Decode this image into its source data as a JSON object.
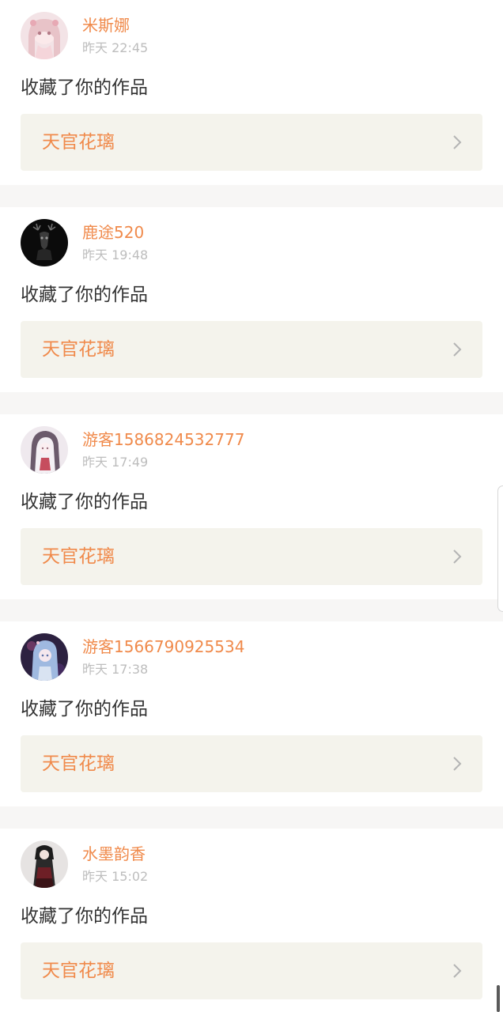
{
  "notifications": [
    {
      "username": "米斯娜",
      "time": "昨天 22:45",
      "action": "收藏了你的作品",
      "work_title": "天官花璃",
      "avatar_icon": "avatar-pink-anime-girl"
    },
    {
      "username": "鹿途520",
      "time": "昨天 19:48",
      "action": "收藏了你的作品",
      "work_title": "天官花璃",
      "avatar_icon": "avatar-deer-skull-dark"
    },
    {
      "username": "游客1586824532777",
      "time": "昨天 17:49",
      "action": "收藏了你的作品",
      "work_title": "天官花璃",
      "avatar_icon": "avatar-hooded-white-hair-girl"
    },
    {
      "username": "游客1566790925534",
      "time": "昨天 17:38",
      "action": "收藏了你的作品",
      "work_title": "天官花璃",
      "avatar_icon": "avatar-blue-hair-anime-girl"
    },
    {
      "username": "水墨韵香",
      "time": "昨天 15:02",
      "action": "收藏了你的作品",
      "work_title": "天官花璃",
      "avatar_icon": "avatar-dark-dress-figure"
    }
  ],
  "colors": {
    "accent": "#f08a4b",
    "timestamp": "#bdbdbd",
    "card_link_bg": "#f4f3ec",
    "separator": "#f7f6f5"
  }
}
